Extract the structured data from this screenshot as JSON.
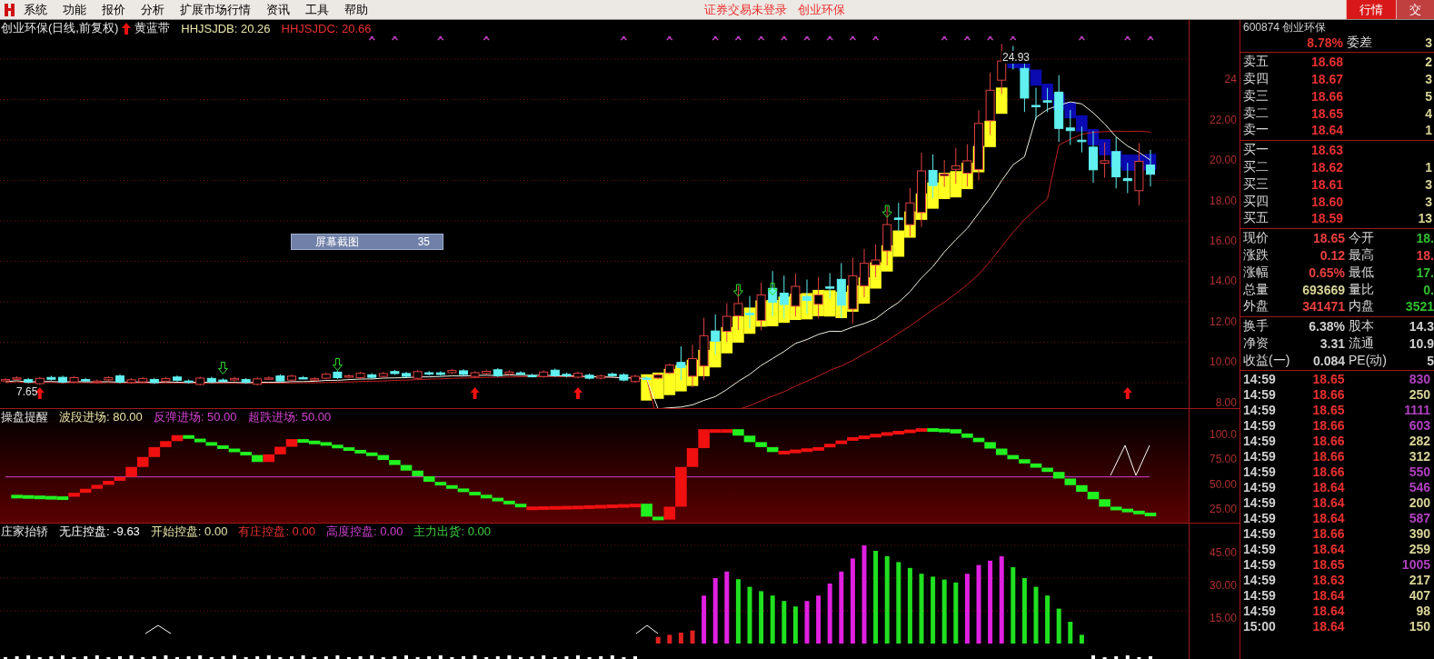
{
  "menu_bar": {
    "items": [
      "系统",
      "功能",
      "报价",
      "分析",
      "扩展市场行情",
      "资讯",
      "工具",
      "帮助"
    ],
    "status": "证券交易未登录",
    "stock": "创业环保",
    "tabs": [
      {
        "label": "行情",
        "selected": true
      },
      {
        "label": "交",
        "selected": false
      }
    ]
  },
  "main_chart": {
    "title": "创业环保(日线,前复权)",
    "indicator": "黄蓝带",
    "readings": [
      {
        "label": "HHJSJDB: 20.26",
        "color": "#e8e4a8"
      },
      {
        "label": "HHJSJDC: 20.66",
        "color": "#e83030"
      }
    ],
    "high_label": "24.93",
    "low_label": "7.65",
    "y_axis": [
      "24",
      "22.00",
      "20.00",
      "18.00",
      "16.00",
      "14.00",
      "12.00",
      "10.00",
      "8.00"
    ],
    "tooltip": {
      "label": "屏幕截图",
      "value": "35"
    }
  },
  "oscillator": {
    "title": "操盘提醒",
    "readings": [
      {
        "label": "波段进场: 80.00",
        "color": "#e8e4a8"
      },
      {
        "label": "反弹进场: 50.00",
        "color": "#d040d0"
      },
      {
        "label": "超跌进场: 50.00",
        "color": "#d040d0"
      }
    ],
    "y_axis": [
      "100.0",
      "75.00",
      "50.00",
      "25.00"
    ]
  },
  "volume_indicator": {
    "title": "庄家抬轿",
    "readings": [
      {
        "label": "无庄控盘: -9.63",
        "color": "#ffffff"
      },
      {
        "label": "开始控盘: 0.00",
        "color": "#e8e4a8"
      },
      {
        "label": "有庄控盘: 0.00",
        "color": "#e83030"
      },
      {
        "label": "高度控盘: 0.00",
        "color": "#d040d0"
      },
      {
        "label": "主力出货: 0.00",
        "color": "#40d040"
      }
    ],
    "y_axis": [
      "45.00",
      "30.00",
      "15.00"
    ]
  },
  "quote_panel": {
    "code": "600874 创业环保",
    "ratio": "8.78%",
    "ratio_label": "委差",
    "ratio_value": "3",
    "sells": [
      {
        "label": "卖五",
        "price": "18.68",
        "volume": "2"
      },
      {
        "label": "卖四",
        "price": "18.67",
        "volume": "3"
      },
      {
        "label": "卖三",
        "price": "18.66",
        "volume": "5"
      },
      {
        "label": "卖二",
        "price": "18.65",
        "volume": "4"
      },
      {
        "label": "卖一",
        "price": "18.64",
        "volume": "1"
      }
    ],
    "buys": [
      {
        "label": "买一",
        "price": "18.63"
      },
      {
        "label": "买二",
        "price": "18.62",
        "volume": "1"
      },
      {
        "label": "买三",
        "price": "18.61",
        "volume": "3"
      },
      {
        "label": "买四",
        "price": "18.60",
        "volume": "3"
      },
      {
        "label": "买五",
        "price": "18.59",
        "volume": "13"
      }
    ],
    "stats": [
      {
        "label": "现价",
        "value": "18.65",
        "color": "#e84040"
      },
      {
        "label": "今开",
        "value": "18.",
        "color": "#30c030"
      },
      {
        "label": "涨跌",
        "value": "0.12",
        "color": "#e84040"
      },
      {
        "label": "最高",
        "value": "18.",
        "color": "#e84040"
      },
      {
        "label": "涨幅",
        "value": "0.65%",
        "color": "#e84040"
      },
      {
        "label": "最低",
        "value": "17.",
        "color": "#30c030"
      },
      {
        "label": "总量",
        "value": "693669",
        "color": "#d8d498"
      },
      {
        "label": "量比",
        "value": "0.",
        "color": "#30c030"
      },
      {
        "label": "外盘",
        "value": "341471",
        "color": "#e84040"
      },
      {
        "label": "内盘",
        "value": "3521",
        "color": "#30c030"
      }
    ],
    "stats2": [
      {
        "label": "换手",
        "value": "6.38%"
      },
      {
        "label": "股本",
        "value": "14.3"
      },
      {
        "label": "净资",
        "value": "3.31"
      },
      {
        "label": "流通",
        "value": "10.9"
      },
      {
        "label": "收益(一)",
        "value": "0.084"
      },
      {
        "label": "PE(动)",
        "value": "5"
      }
    ],
    "ticks": [
      {
        "time": "14:59",
        "price": "18.65",
        "volume": "830",
        "color": "#b040c0"
      },
      {
        "time": "14:59",
        "price": "18.66",
        "volume": "250",
        "color": "#d8d498"
      },
      {
        "time": "14:59",
        "price": "18.65",
        "volume": "1111",
        "color": "#b040c0"
      },
      {
        "time": "14:59",
        "price": "18.66",
        "volume": "603",
        "color": "#b040c0"
      },
      {
        "time": "14:59",
        "price": "18.66",
        "volume": "282",
        "color": "#d8d498"
      },
      {
        "time": "14:59",
        "price": "18.66",
        "volume": "312",
        "color": "#d8d498"
      },
      {
        "time": "14:59",
        "price": "18.66",
        "volume": "550",
        "color": "#b040c0"
      },
      {
        "time": "14:59",
        "price": "18.64",
        "volume": "546",
        "color": "#b040c0"
      },
      {
        "time": "14:59",
        "price": "18.64",
        "volume": "200",
        "color": "#d8d498"
      },
      {
        "time": "14:59",
        "price": "18.64",
        "volume": "587",
        "color": "#b040c0"
      },
      {
        "time": "14:59",
        "price": "18.66",
        "volume": "390",
        "color": "#d8d498"
      },
      {
        "time": "14:59",
        "price": "18.64",
        "volume": "259",
        "color": "#d8d498"
      },
      {
        "time": "14:59",
        "price": "18.65",
        "volume": "1005",
        "color": "#b040c0"
      },
      {
        "time": "14:59",
        "price": "18.63",
        "volume": "217",
        "color": "#d8d498"
      },
      {
        "time": "14:59",
        "price": "18.64",
        "volume": "407",
        "color": "#d8d498"
      },
      {
        "time": "14:59",
        "price": "18.64",
        "volume": "98",
        "color": "#d8d498"
      },
      {
        "time": "15:00",
        "price": "18.64",
        "volume": "150",
        "color": "#d8d498"
      }
    ]
  }
}
